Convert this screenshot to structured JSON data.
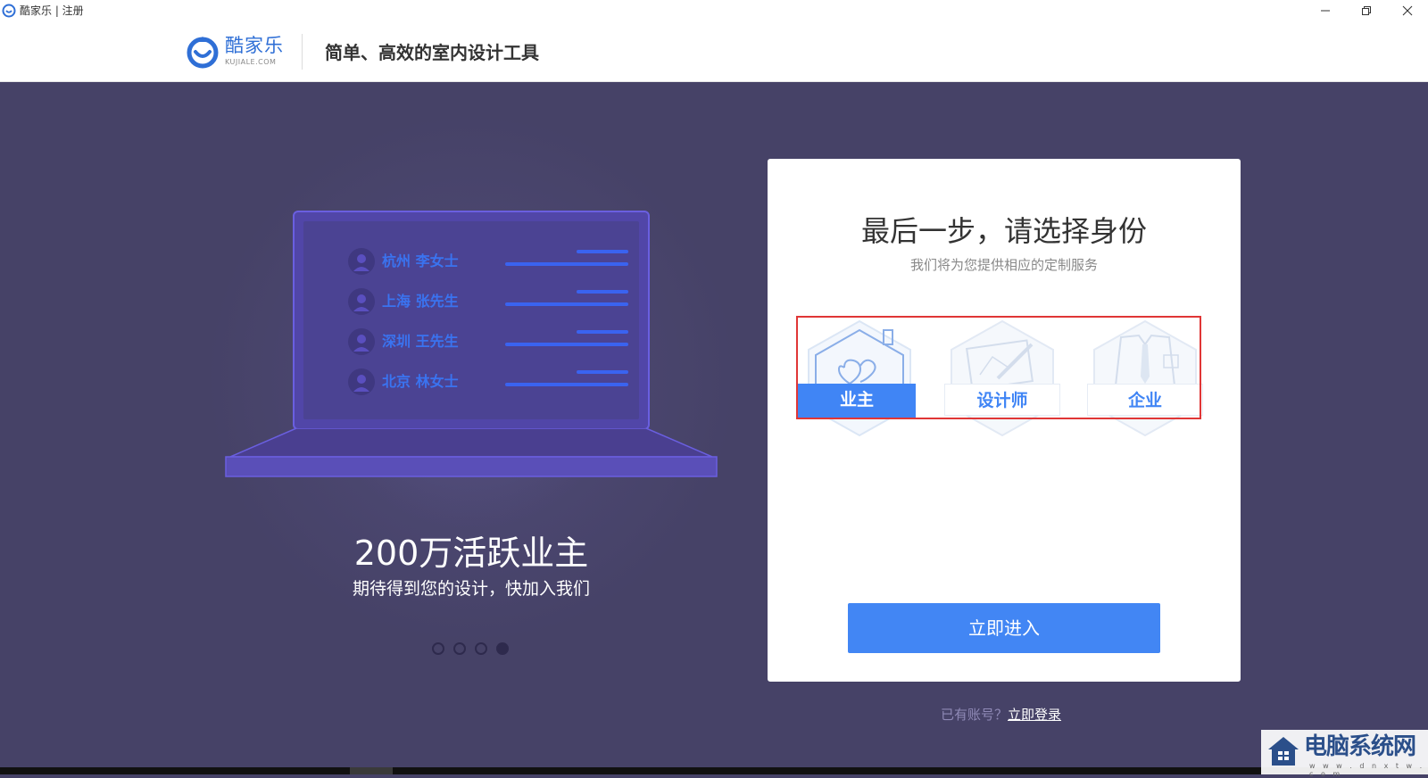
{
  "window": {
    "title": "酷家乐 | 注册"
  },
  "header": {
    "logo_text": "酷家乐",
    "logo_sub": "KUJIALE.COM",
    "slogan": "简单、高效的室内设计工具"
  },
  "carousel": {
    "users": [
      {
        "label": "杭州  李女士"
      },
      {
        "label": "上海  张先生"
      },
      {
        "label": "深圳  王先生"
      },
      {
        "label": "北京  林女士"
      }
    ],
    "title": "200万活跃业主",
    "subtitle": "期待得到您的设计，快加入我们",
    "dots": [
      false,
      false,
      false,
      true
    ]
  },
  "card": {
    "title": "最后一步，请选择身份",
    "subtitle": "我们将为您提供相应的定制服务",
    "roles": [
      {
        "label": "业主",
        "selected": true,
        "icon": "house-heart-icon"
      },
      {
        "label": "设计师",
        "selected": false,
        "icon": "drawing-pencil-icon"
      },
      {
        "label": "企业",
        "selected": false,
        "icon": "shirt-tie-icon"
      }
    ],
    "enter_button": "立即进入"
  },
  "login": {
    "prompt": "已有账号？",
    "link": "立即登录"
  },
  "watermark": {
    "text": "电脑系统网",
    "url": "w w w . d n x t w . c o m"
  },
  "colors": {
    "background": "#464267",
    "accent": "#4286f4",
    "highlight_border": "#e03636"
  }
}
